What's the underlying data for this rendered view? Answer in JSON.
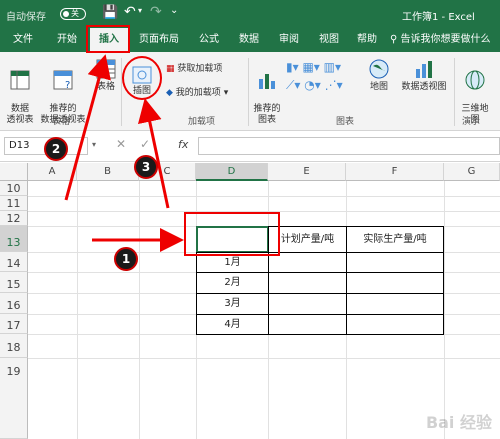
{
  "titlebar": {
    "autosave_label": "自动保存",
    "autosave_state": "关",
    "title": "工作簿1 - Excel"
  },
  "tabs": [
    {
      "label": "文件"
    },
    {
      "label": "开始"
    },
    {
      "label": "插入",
      "active": true
    },
    {
      "label": "页面布局"
    },
    {
      "label": "公式"
    },
    {
      "label": "数据"
    },
    {
      "label": "审阅"
    },
    {
      "label": "视图"
    },
    {
      "label": "帮助"
    }
  ],
  "tell_me": "告诉我你想要做什么",
  "ribbon": {
    "pivot_table": "数据\n透视表",
    "recommended_pivot": "推荐的\n数据透视表",
    "table": "表格",
    "group_tables": "表格",
    "illustrations": "插图",
    "get_addins": "获取加载项",
    "my_addins": "我的加载项",
    "group_addins": "加载项",
    "recommended_charts": "推荐的\n图表",
    "maps": "地图",
    "pivot_chart": "数据透视图",
    "group_charts": "图表",
    "map_3d": "三维地\n图",
    "group_tours": "演示"
  },
  "formula_bar": {
    "name_box": "D13",
    "fx": "fx",
    "value": ""
  },
  "columns": [
    "A",
    "B",
    "C",
    "D",
    "E",
    "F",
    "G"
  ],
  "selected_column": "D",
  "rows": [
    "10",
    "11",
    "12",
    "13",
    "14",
    "15",
    "16",
    "17",
    "18",
    "19"
  ],
  "selected_row": "13",
  "table": {
    "header_e": "计划产量/吨",
    "header_f": "实际生产量/吨",
    "months": [
      "1月",
      "2月",
      "3月",
      "4月"
    ]
  },
  "annotations": [
    "1",
    "2",
    "3"
  ],
  "colors": {
    "excel_green": "#217346",
    "annotation_red": "#e00000"
  },
  "watermark": "Bai 经验"
}
